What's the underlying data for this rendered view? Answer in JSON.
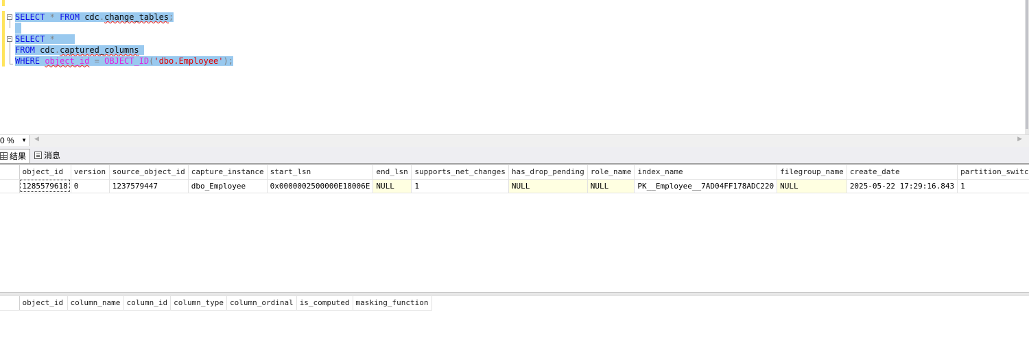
{
  "editor": {
    "lines": [
      [
        {
          "t": "SELECT",
          "c": "kw"
        },
        {
          "t": " ",
          "c": "id"
        },
        {
          "t": "*",
          "c": "op"
        },
        {
          "t": " ",
          "c": "id"
        },
        {
          "t": "FROM",
          "c": "kw"
        },
        {
          "t": " ",
          "c": "id"
        },
        {
          "t": "cdc",
          "c": "id"
        },
        {
          "t": ".",
          "c": "op"
        },
        {
          "t": "change_tables",
          "c": "id wavy"
        },
        {
          "t": ";",
          "c": "op"
        }
      ],
      [],
      [
        {
          "t": "SELECT",
          "c": "kw"
        },
        {
          "t": " ",
          "c": "id"
        },
        {
          "t": "*",
          "c": "op"
        }
      ],
      [
        {
          "t": "FROM",
          "c": "kw"
        },
        {
          "t": " ",
          "c": "id"
        },
        {
          "t": "cdc",
          "c": "id"
        },
        {
          "t": ".",
          "c": "op"
        },
        {
          "t": "captured_columns",
          "c": "id wavy"
        }
      ],
      [
        {
          "t": "WHERE",
          "c": "kw"
        },
        {
          "t": " ",
          "c": "id"
        },
        {
          "t": "object_id",
          "c": "fn wavy"
        },
        {
          "t": " ",
          "c": "id"
        },
        {
          "t": "=",
          "c": "op"
        },
        {
          "t": " ",
          "c": "id"
        },
        {
          "t": "OBJECT_ID",
          "c": "fn"
        },
        {
          "t": "(",
          "c": "op"
        },
        {
          "t": "'dbo.Employee'",
          "c": "str"
        },
        {
          "t": ")",
          "c": "op"
        },
        {
          "t": ";",
          "c": "op"
        }
      ]
    ]
  },
  "zoom": {
    "value": "0 %"
  },
  "tabs": {
    "results": "结果",
    "messages": "消息"
  },
  "grid1": {
    "columns": [
      "object_id",
      "version",
      "source_object_id",
      "capture_instance",
      "start_lsn",
      "end_lsn",
      "supports_net_changes",
      "has_drop_pending",
      "role_name",
      "index_name",
      "filegroup_name",
      "create_date",
      "partition_switch"
    ],
    "row": [
      "1285579618",
      "0",
      "1237579447",
      "dbo_Employee",
      "0x0000002500000E18006E",
      "NULL",
      "1",
      "NULL",
      "NULL",
      "PK__Employee__7AD04FF178ADC220",
      "NULL",
      "2025-05-22 17:29:16.843",
      "1"
    ]
  },
  "grid2": {
    "columns": [
      "object_id",
      "column_name",
      "column_id",
      "column_type",
      "column_ordinal",
      "is_computed",
      "masking_function"
    ]
  },
  "colors": {
    "selection": "#99c9ef",
    "keyword": "#1010e8",
    "function": "#e020e0",
    "string": "#e00000",
    "null_cell": "#ffffe1"
  }
}
